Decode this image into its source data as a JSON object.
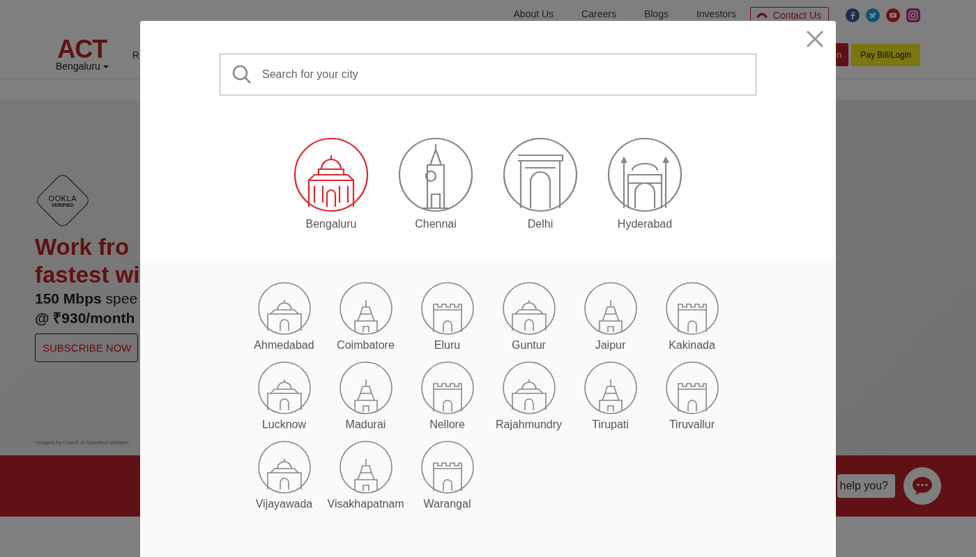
{
  "top_links": [
    "About Us",
    "Careers",
    "Blogs",
    "Investors"
  ],
  "contact_button": "Contact Us",
  "logo": "ACT",
  "city_selector": "Bengaluru",
  "nav_fragment": "R",
  "red_button_fragment": "n",
  "pay_button": "Pay Bill/Login",
  "banner": {
    "badge_top": "OOKLA",
    "badge_bottom": "VERIFIED",
    "headline_1": "Work fro",
    "headline_2": "fastest wi",
    "speed": "150 Mbps",
    "speed_rest": "spee",
    "price": "@ ₹930/month",
    "cta": "SUBSCRIBE NOW",
    "footnote": "*Analysis by Ookla® of Speedtest Intelligen"
  },
  "chat_bubble": "help you?",
  "modal": {
    "search": {
      "placeholder": "Search for your city"
    },
    "featured_cities": [
      {
        "name": "Bengaluru",
        "selected": true
      },
      {
        "name": "Chennai",
        "selected": false
      },
      {
        "name": "Delhi",
        "selected": false
      },
      {
        "name": "Hyderabad",
        "selected": false
      }
    ],
    "other_cities": [
      {
        "name": "Ahmedabad"
      },
      {
        "name": "Coimbatore"
      },
      {
        "name": "Eluru"
      },
      {
        "name": "Guntur"
      },
      {
        "name": "Jaipur"
      },
      {
        "name": "Kakinada"
      },
      {
        "name": "Lucknow"
      },
      {
        "name": "Madurai"
      },
      {
        "name": "Nellore"
      },
      {
        "name": "Rajahmundry"
      },
      {
        "name": "Tirupati"
      },
      {
        "name": "Tiruvallur"
      },
      {
        "name": "Vijayawada"
      },
      {
        "name": "Visakhapatnam"
      },
      {
        "name": "Warangal"
      }
    ]
  }
}
